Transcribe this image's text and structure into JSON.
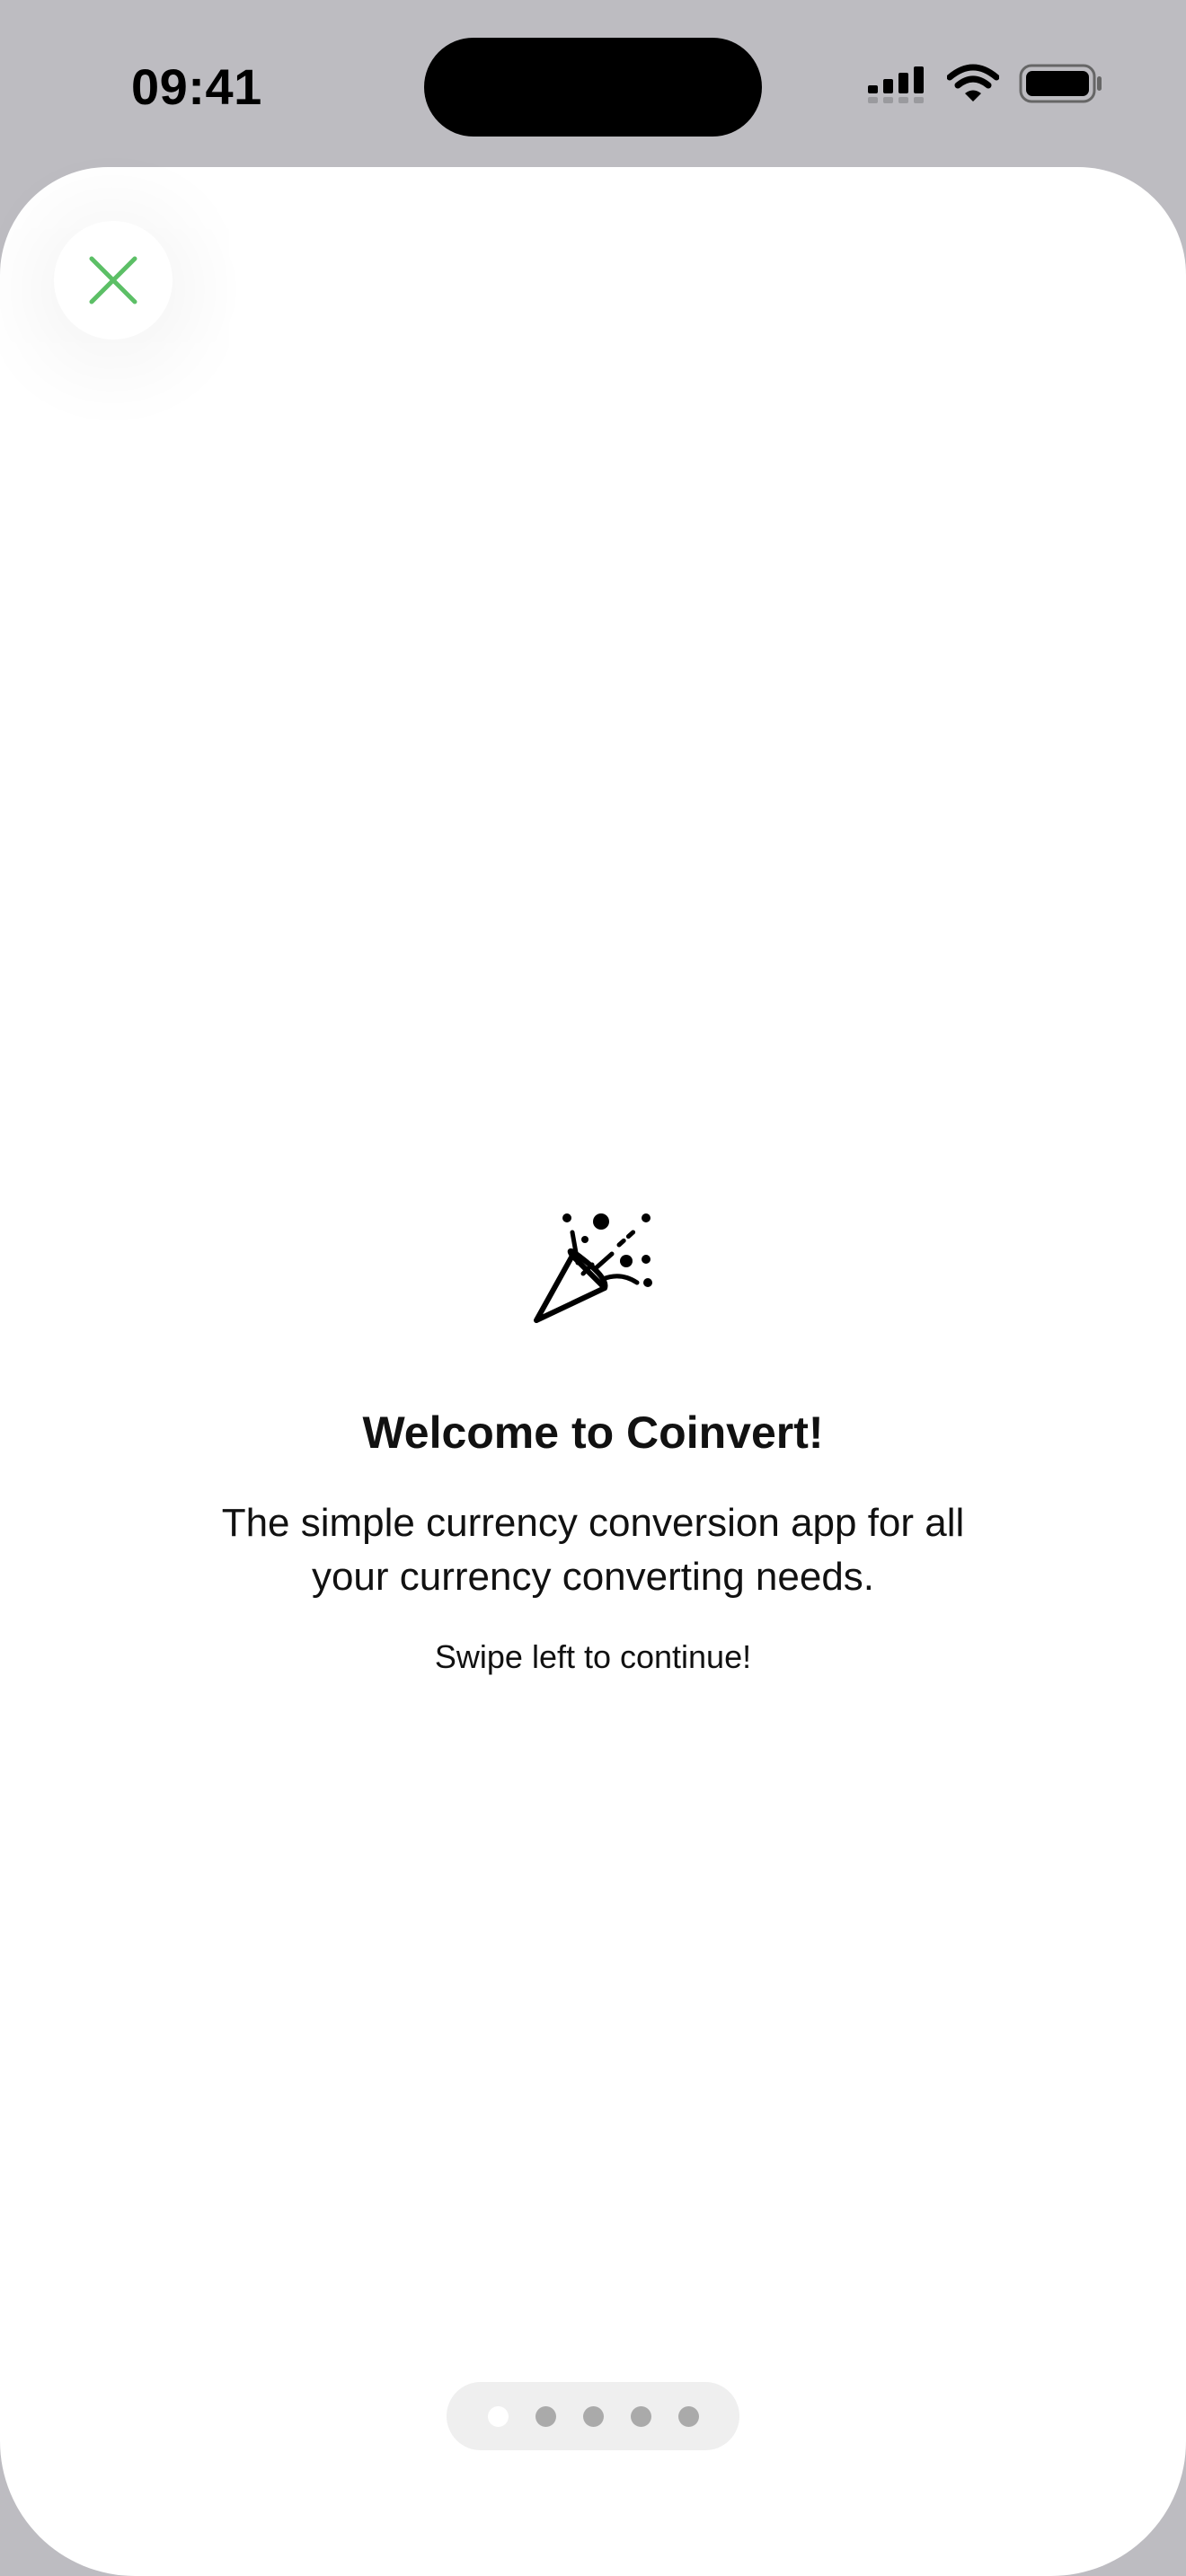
{
  "status_bar": {
    "time": "09:41",
    "icons": [
      "cellular-signal-icon",
      "wifi-icon",
      "battery-icon"
    ]
  },
  "close_button": {
    "icon": "close-icon",
    "color": "#5cbf66"
  },
  "welcome": {
    "icon": "party-popper-icon",
    "title": "Welcome to Coinvert!",
    "subtitle": "The simple currency conversion app for all your currency converting needs.",
    "hint": "Swipe left to continue!"
  },
  "pagination": {
    "total_pages": 5,
    "current_page": 1
  }
}
